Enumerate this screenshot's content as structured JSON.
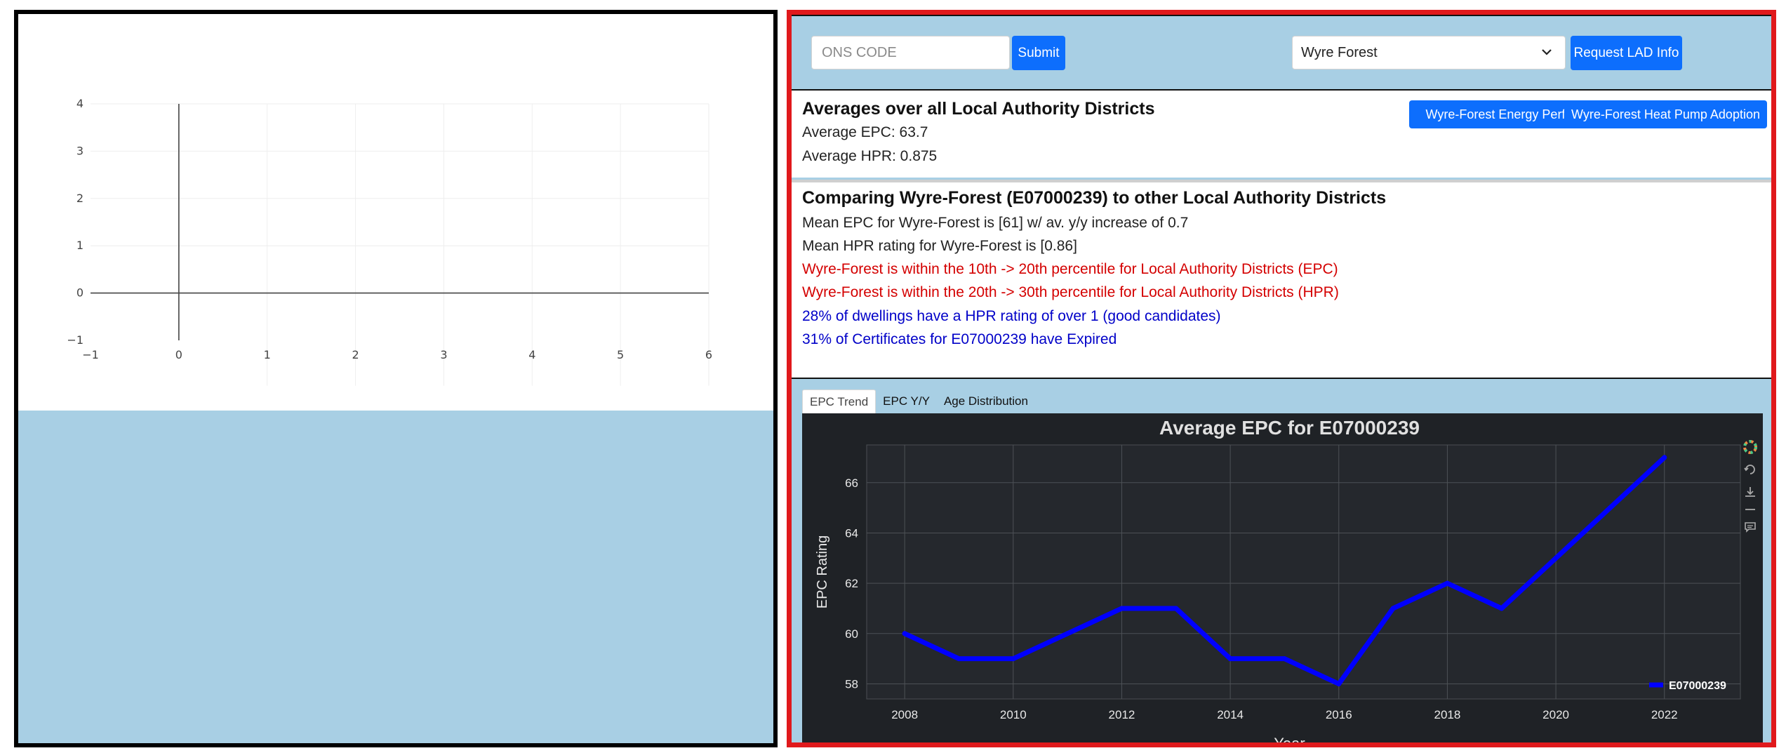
{
  "left_plot": {
    "x_ticks": [
      "−1",
      "0",
      "1",
      "2",
      "3",
      "4",
      "5",
      "6"
    ],
    "y_ticks": [
      "−1",
      "0",
      "1",
      "2",
      "3",
      "4"
    ]
  },
  "controls": {
    "ons_placeholder": "ONS CODE",
    "submit_label": "Submit",
    "lad_selected": "Wyre Forest",
    "lad_button_label": "Request LAD Info"
  },
  "averages": {
    "title": "Averages over all Local Authority Districts",
    "avg_epc": "Average EPC: 63.7",
    "avg_hpr": "Average HPR: 0.875",
    "energy_perf_button": "Wyre-Forest Energy Perf",
    "heat_pump_button": "Wyre-Forest Heat Pump Adoption"
  },
  "comparison": {
    "title": "Comparing Wyre-Forest (E07000239) to other Local Authority Districts",
    "mean_epc": "Mean EPC for Wyre-Forest is [61] w/ av. y/y increase of 0.7",
    "mean_hpr": "Mean HPR rating for Wyre-Forest is [0.86]",
    "epc_percentile": "Wyre-Forest is within the 10th -> 20th percentile for Local Authority Districts (EPC)",
    "hpr_percentile": "Wyre-Forest is within the 20th -> 30th percentile for Local Authority Districts (HPR)",
    "hpr_candidates": "28% of dwellings have a HPR rating of over 1 (good candidates)",
    "expired": "31% of Certificates for E07000239 have Expired"
  },
  "tabs": [
    "EPC Trend",
    "EPC Y/Y",
    "Age Distribution"
  ],
  "colors": {
    "accent": "#0d6efd",
    "panel_bg": "#a8cfe4",
    "highlight_border": "#e0191c",
    "red_text": "#d40000",
    "blue_text": "#0000c8",
    "series": "#0000ff",
    "chart_bg": "#1f2226"
  },
  "modebar_icons": [
    "colorwheel-icon",
    "reset-icon",
    "download-icon",
    "divider-icon",
    "comment-icon"
  ],
  "chart_data": {
    "type": "line",
    "title": "Average EPC for E07000239",
    "xlabel": "Year",
    "ylabel": "EPC Rating",
    "xlim": [
      2007.3,
      2023.4
    ],
    "ylim": [
      57.4,
      67.5
    ],
    "x_ticks": [
      2008,
      2010,
      2012,
      2014,
      2016,
      2018,
      2020,
      2022
    ],
    "y_ticks": [
      58,
      60,
      62,
      64,
      66
    ],
    "grid": true,
    "legend_position": "bottom-right",
    "series": [
      {
        "name": "E07000239",
        "x": [
          2008,
          2009,
          2010,
          2011,
          2012,
          2013,
          2014,
          2015,
          2016,
          2017,
          2018,
          2019,
          2020,
          2021,
          2022
        ],
        "y": [
          60,
          59,
          59,
          60,
          61,
          61,
          59,
          59,
          58,
          61,
          62,
          61,
          63,
          65,
          67
        ]
      }
    ]
  }
}
